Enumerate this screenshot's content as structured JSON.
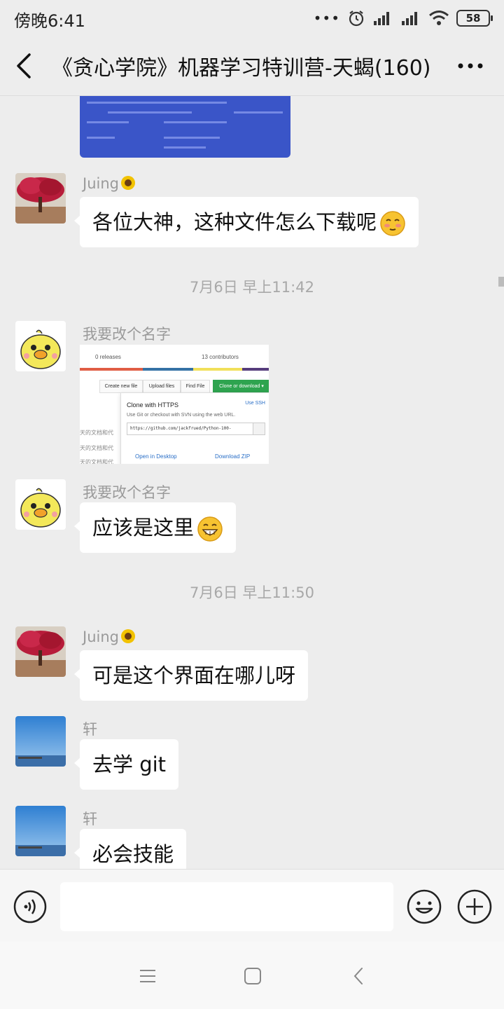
{
  "status_bar": {
    "time": "傍晚6:41",
    "more_dots": "•••",
    "battery": "58"
  },
  "header": {
    "title": "《贪心学院》机器学习特训营-天蝎(160)"
  },
  "messages": [
    {
      "type": "image",
      "sender": "",
      "description": "screenshot"
    },
    {
      "type": "text",
      "sender": "Juing",
      "text": "各位大神，这种文件怎么下载呢",
      "emoji": "blush-face"
    },
    {
      "type": "timestamp",
      "text": "7月6日 早上11:42"
    },
    {
      "type": "image",
      "sender": "我要改个名字"
    },
    {
      "type": "text",
      "sender": "我要改个名字",
      "text": "应该是这里",
      "emoji": "grin-face"
    },
    {
      "type": "timestamp",
      "text": "7月6日 早上11:50"
    },
    {
      "type": "text",
      "sender": "Juing",
      "text": "可是这个界面在哪儿呀"
    },
    {
      "type": "text",
      "sender": "轩",
      "text": "去学 git"
    },
    {
      "type": "text",
      "sender": "轩",
      "text": "必会技能"
    }
  ],
  "github_shot": {
    "releases": "0 releases",
    "contributors": "13 contributors",
    "create_file": "Create new file",
    "upload_files": "Upload files",
    "find_file": "Find File",
    "clone_download": "Clone or download ▾",
    "clone_title": "Clone with HTTPS",
    "use_ssh": "Use SSH",
    "clone_desc": "Use Git or checkout with SVN using the web URL.",
    "clone_url": "https://github.com/jackfrued/Python-100-",
    "open_desktop": "Open in Desktop",
    "download_zip": "Download ZIP",
    "side_text": "天的文档和代"
  },
  "input": {
    "placeholder": ""
  },
  "colors": {
    "background": "#ededed",
    "bubble": "#ffffff",
    "timestamp": "#a8a8a8",
    "github_green": "#2ea44f"
  }
}
